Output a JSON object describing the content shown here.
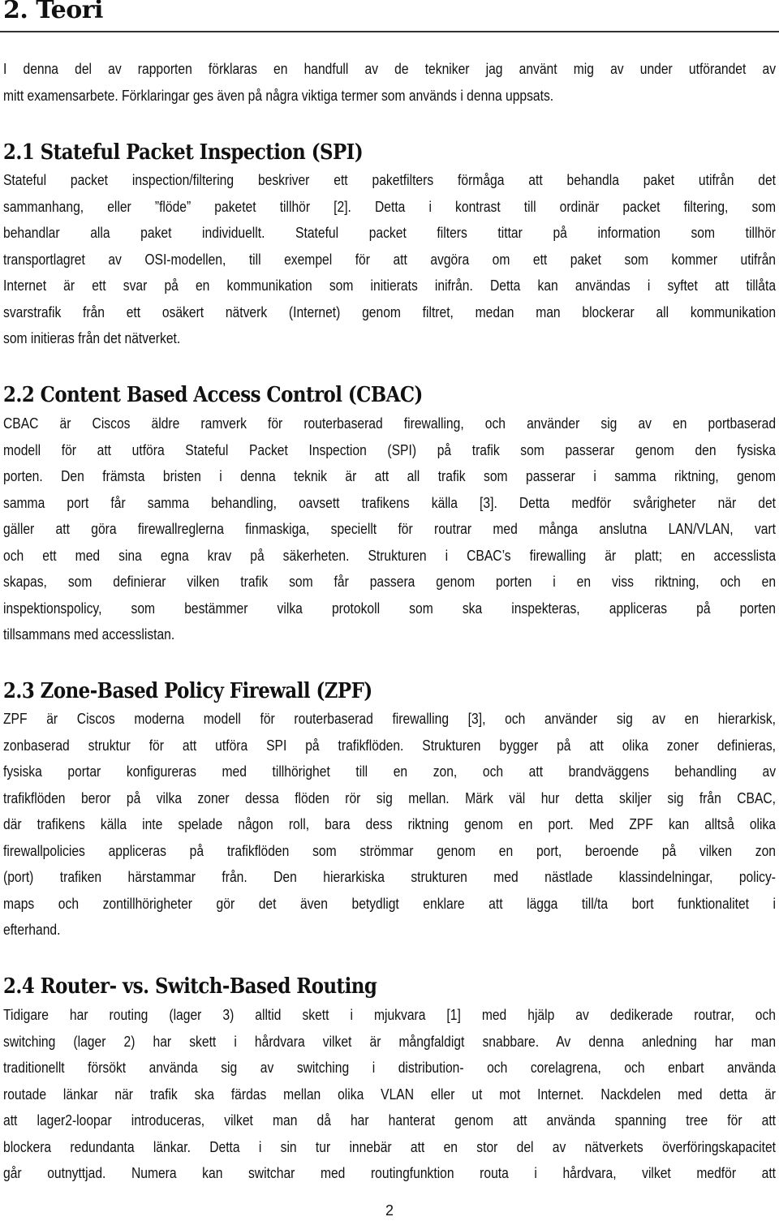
{
  "chapter": {
    "title": "2. Teori",
    "intro": [
      "I denna del av rapporten förklaras en handfull av de tekniker jag använt mig av under utförandet av",
      "mitt examensarbete. Förklaringar ges även på några viktiga termer som används i denna uppsats."
    ]
  },
  "sections": [
    {
      "title": "2.1 Stateful Packet Inspection (SPI)",
      "lines": [
        "Stateful packet inspection/filtering beskriver ett paketfilters förmåga att behandla paket utifrån det",
        "sammanhang, eller ”flöde” paketet tillhör [2]. Detta i kontrast till ordinär packet filtering, som",
        "behandlar alla paket individuellt. Stateful packet filters tittar på information som tillhör",
        "transportlagret av OSI-modellen, till exempel för att avgöra om ett paket som kommer utifrån",
        "Internet är ett svar på en kommunikation som initierats inifrån. Detta kan användas i syftet att tillåta",
        "svarstrafik från ett osäkert nätverk (Internet) genom filtret, medan man blockerar all kommunikation",
        "som initieras från det nätverket."
      ]
    },
    {
      "title": "2.2 Content Based Access Control (CBAC)",
      "lines": [
        "CBAC är Ciscos äldre ramverk för routerbaserad firewalling, och använder sig av en portbaserad",
        "modell för att utföra Stateful Packet Inspection (SPI) på trafik som passerar genom den fysiska",
        "porten. Den främsta bristen i denna teknik är att all trafik som passerar i samma riktning, genom",
        "samma port får samma behandling, oavsett trafikens källa [3]. Detta medför svårigheter när det",
        "gäller att göra firewallreglerna finmaskiga, speciellt för routrar med många anslutna LAN/VLAN, vart",
        "och ett med sina egna krav på säkerheten. Strukturen i CBAC’s firewalling är platt; en accesslista",
        "skapas, som definierar vilken trafik som får passera genom porten i en viss riktning, och en",
        "inspektionspolicy, som bestämmer vilka protokoll som ska inspekteras, appliceras på porten",
        "tillsammans med accesslistan."
      ]
    },
    {
      "title": "2.3 Zone-Based Policy Firewall (ZPF)",
      "lines": [
        "ZPF är Ciscos moderna modell för routerbaserad firewalling [3], och använder sig av en hierarkisk,",
        "zonbaserad struktur för att utföra SPI på trafikflöden. Strukturen bygger på att olika zoner definieras,",
        "fysiska portar konfigureras med tillhörighet till en zon, och att brandväggens behandling av",
        "trafikflöden beror på vilka zoner dessa flöden rör sig mellan. Märk väl hur detta skiljer sig från CBAC,",
        "där trafikens källa inte spelade någon roll, bara dess riktning genom en port. Med ZPF kan alltså olika",
        "firewallpolicies appliceras på trafikflöden som strömmar genom en port, beroende på vilken zon",
        "(port) trafiken härstammar från. Den hierarkiska strukturen med nästlade klassindelningar, policy-",
        "maps och zontillhörigheter gör det även betydligt enklare att lägga till/ta bort funktionalitet i",
        "efterhand."
      ]
    },
    {
      "title": "2.4 Router- vs. Switch-Based Routing",
      "lines": [
        "Tidigare har routing (lager 3) alltid skett i mjukvara [1] med hjälp av dedikerade routrar, och",
        "switching (lager 2) har skett i hårdvara vilket är mångfaldigt snabbare. Av denna anledning har man",
        "traditionellt försökt använda sig av switching i distribution- och corelagrena, och enbart använda",
        "routade länkar när trafik ska färdas mellan olika VLAN eller ut mot Internet. Nackdelen med detta är",
        "att lager2-loopar introduceras, vilket man då har hanterat genom att använda spanning tree för att",
        "blockera redundanta länkar. Detta i sin tur innebär att en stor del av nätverkets överföringskapacitet",
        "går outnyttjad. Numera kan switchar med routingfunktion routa i hårdvara, vilket medför att"
      ]
    }
  ],
  "footer": {
    "page_number": "2"
  }
}
